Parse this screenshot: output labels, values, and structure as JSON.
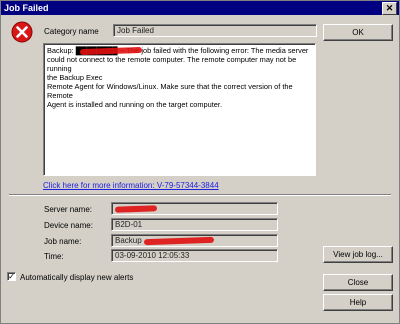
{
  "window": {
    "title": "Job Failed",
    "close_glyph": "✕"
  },
  "category": {
    "label": "Category name",
    "value": "Job Failed"
  },
  "message": {
    "lines": [
      "Backup: ████████ -- The job failed with the following error: The media server",
      "could not connect to the remote computer. The remote computer may not be running",
      "the Backup Exec",
      "Remote Agent for Windows/Linux. Make sure that the correct version of the Remote",
      "Agent is installed and running on the target computer."
    ]
  },
  "link": {
    "text": "Click here for more information: V-79-57344-3844"
  },
  "details": {
    "server_label": "Server name:",
    "server_value": "",
    "device_label": "Device name:",
    "device_value": "B2D-01",
    "job_label": "Job name:",
    "job_value": "Backup",
    "time_label": "Time:",
    "time_value": "03-09-2010 12:05:33"
  },
  "buttons": {
    "ok": "OK",
    "view_log": "View job log...",
    "close": "Close",
    "help": "Help"
  },
  "checkbox": {
    "label": "Automatically display new alerts",
    "checked": true,
    "mark": "✓"
  },
  "colors": {
    "title_bar": "#000080",
    "accent_red": "#d81818",
    "link": "#2020e0",
    "background": "#d4d0c8"
  },
  "icons": {
    "error": "error-icon"
  }
}
